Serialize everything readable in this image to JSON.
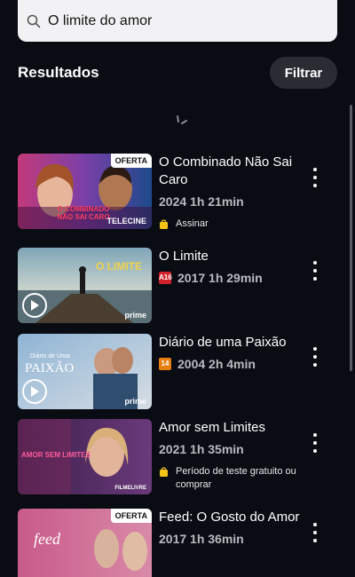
{
  "search": {
    "query": "O limite do amor"
  },
  "header": {
    "title": "Resultados",
    "filter_label": "Filtrar"
  },
  "results": [
    {
      "title": "O Combinado Não Sai Caro",
      "meta": "2024 1h 21min",
      "rating": "",
      "badge": "OFERTA",
      "provider": "TELECINE",
      "offer": "Assinar",
      "thumb_text": "O COMBINADO NÃO SAI CARO"
    },
    {
      "title": "O Limite",
      "meta": "2017 1h 29min",
      "rating": "A16",
      "rating_color": "#d0202a",
      "provider": "prime",
      "thumb_text": "O LIMITE"
    },
    {
      "title": "Diário de uma Paixão",
      "meta": "2004 2h 4min",
      "rating": "14",
      "rating_color": "#e67e10",
      "provider": "prime",
      "thumb_text": "PAIXÃO",
      "thumb_small": "Diário de Uma"
    },
    {
      "title": "Amor sem Limites",
      "meta": "2021 1h 35min",
      "rating": "",
      "provider": "FILMELIVRE",
      "offer": "Período de teste gratuito ou comprar",
      "thumb_text": "AMOR SEM LIMITES"
    },
    {
      "title": "Feed: O Gosto do Amor",
      "meta": "2017 1h 36min",
      "rating": "",
      "badge": "OFERTA",
      "thumb_text": "feed"
    }
  ],
  "colors": {
    "background": "#0a0c14",
    "search_bg": "#f2f2f4",
    "offer_icon": "#f5c518"
  }
}
